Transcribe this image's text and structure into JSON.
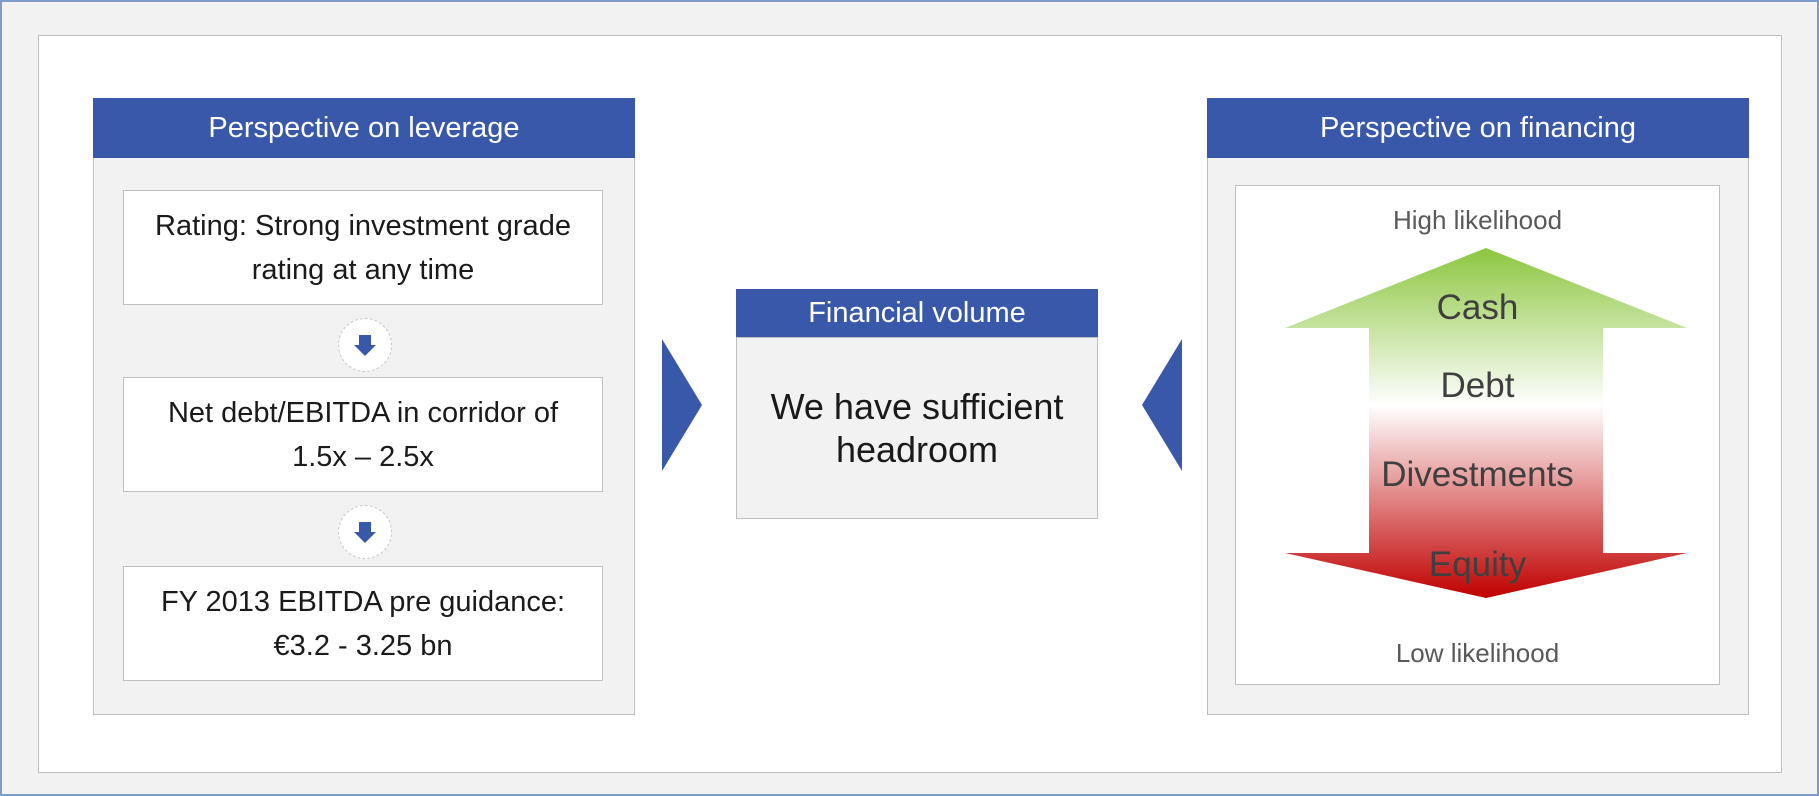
{
  "left_panel": {
    "title": "Perspective on leverage",
    "items": [
      "Rating: Strong investment grade rating at any time",
      "Net debt/EBITDA in corridor of 1.5x – 2.5x",
      "FY 2013 EBITDA pre guidance: €3.2 - 3.25 bn"
    ]
  },
  "center": {
    "title": "Financial volume",
    "text": "We have sufficient headroom"
  },
  "right_panel": {
    "title": "Perspective on financing",
    "top_label": "High likelihood",
    "bottom_label": "Low likelihood",
    "items": [
      "Cash",
      "Debt",
      "Divestments",
      "Equity"
    ]
  },
  "colors": {
    "header_blue": "#3a58a9",
    "arrow_top_green": "#8cc63f",
    "arrow_bottom_red": "#c00000"
  }
}
